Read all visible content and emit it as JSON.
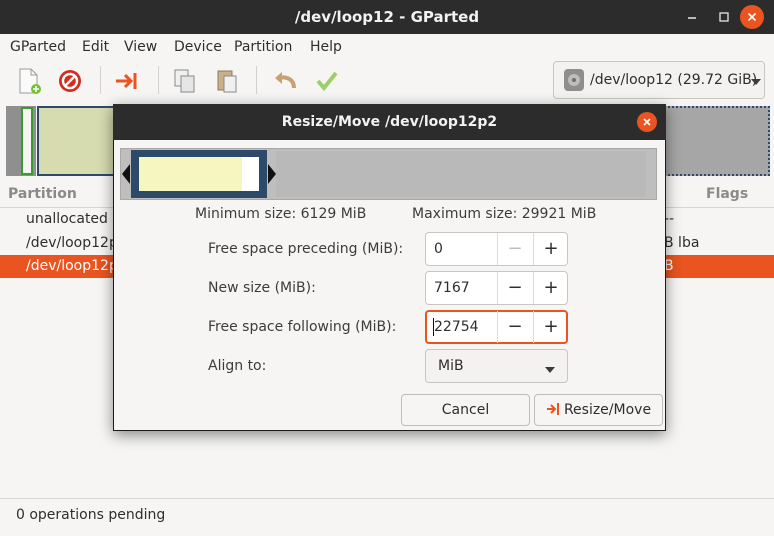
{
  "window": {
    "title": "/dev/loop12 - GParted"
  },
  "menu": [
    "GParted",
    "Edit",
    "View",
    "Device",
    "Partition",
    "Help"
  ],
  "device_selector": {
    "value": "/dev/loop12 (29.72 GiB)"
  },
  "partition_list": {
    "headers": {
      "partition": "Partition",
      "flags": "Flags"
    },
    "rows": [
      {
        "name": "unallocated",
        "flags": "--"
      },
      {
        "name": "/dev/loop12p",
        "flags": "B  lba"
      },
      {
        "name": "/dev/loop12p",
        "flags": "B"
      }
    ]
  },
  "status_bar": {
    "text": "0 operations pending"
  },
  "dialog": {
    "title": "Resize/Move /dev/loop12p2",
    "minimum_size": "Minimum size: 6129 MiB",
    "maximum_size": "Maximum size: 29921 MiB",
    "fields": [
      {
        "label": "Free space preceding (MiB):",
        "value": "0"
      },
      {
        "label": "New size (MiB):",
        "value": "7167"
      },
      {
        "label": "Free space following (MiB):",
        "value": "22754"
      }
    ],
    "align": {
      "label": "Align to:",
      "value": "MiB"
    },
    "buttons": {
      "cancel": "Cancel",
      "resize": "Resize/Move"
    }
  },
  "colors": {
    "accent": "#e95420",
    "titlebar": "#2c2c2c",
    "partition_fill": "#f5f6c0",
    "partition_border": "#2e4a6b"
  }
}
